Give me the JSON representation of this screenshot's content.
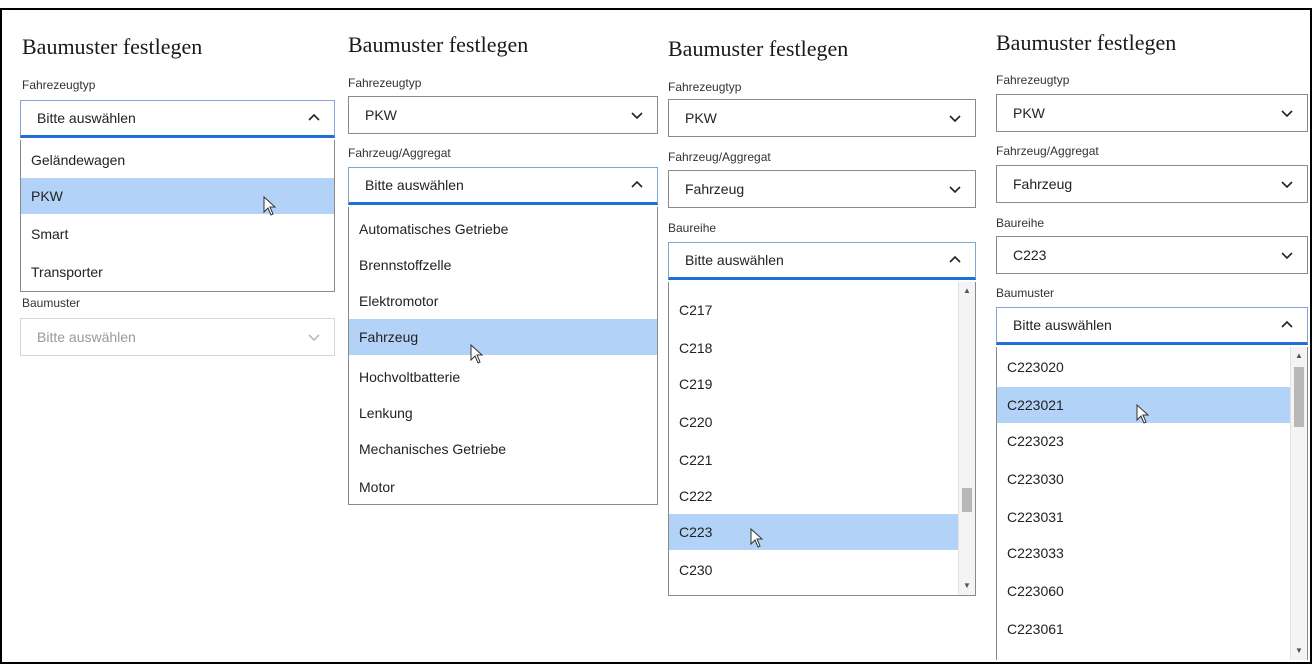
{
  "common": {
    "title": "Baumuster festlegen",
    "placeholder": "Bitte auswählen"
  },
  "labels": {
    "fahrzeugtyp": "Fahrezeugtyp",
    "aggregat": "Fahrzeug/Aggregat",
    "baureihe": "Baureihe",
    "baumuster": "Baumuster"
  },
  "panel1": {
    "options": [
      "Geländewagen",
      "PKW",
      "Smart",
      "Transporter"
    ],
    "selected_index": 1
  },
  "panel2": {
    "fahrzeugtyp_value": "PKW",
    "options": [
      "Automatisches Getriebe",
      "Brennstoffzelle",
      "Elektromotor",
      "Fahrzeug",
      "Hochvoltbatterie",
      "Lenkung",
      "Mechanisches Getriebe",
      "Motor"
    ],
    "selected_index": 3
  },
  "panel3": {
    "fahrzeugtyp_value": "PKW",
    "aggregat_value": "Fahrzeug",
    "options": [
      "C217",
      "C218",
      "C219",
      "C220",
      "C221",
      "C222",
      "C223",
      "C230"
    ],
    "selected_index": 6
  },
  "panel4": {
    "fahrzeugtyp_value": "PKW",
    "aggregat_value": "Fahrzeug",
    "baureihe_value": "C223",
    "options": [
      "C223020",
      "C223021",
      "C223023",
      "C223030",
      "C223031",
      "C223033",
      "C223060",
      "C223061"
    ],
    "selected_index": 1
  },
  "colors": {
    "selection": "#b3d2f7",
    "focus_underline": "#1f6fd6"
  },
  "icons": {
    "chevron_down": "chevron-down-icon",
    "chevron_up": "chevron-up-icon",
    "cursor": "mouse-pointer-icon"
  }
}
